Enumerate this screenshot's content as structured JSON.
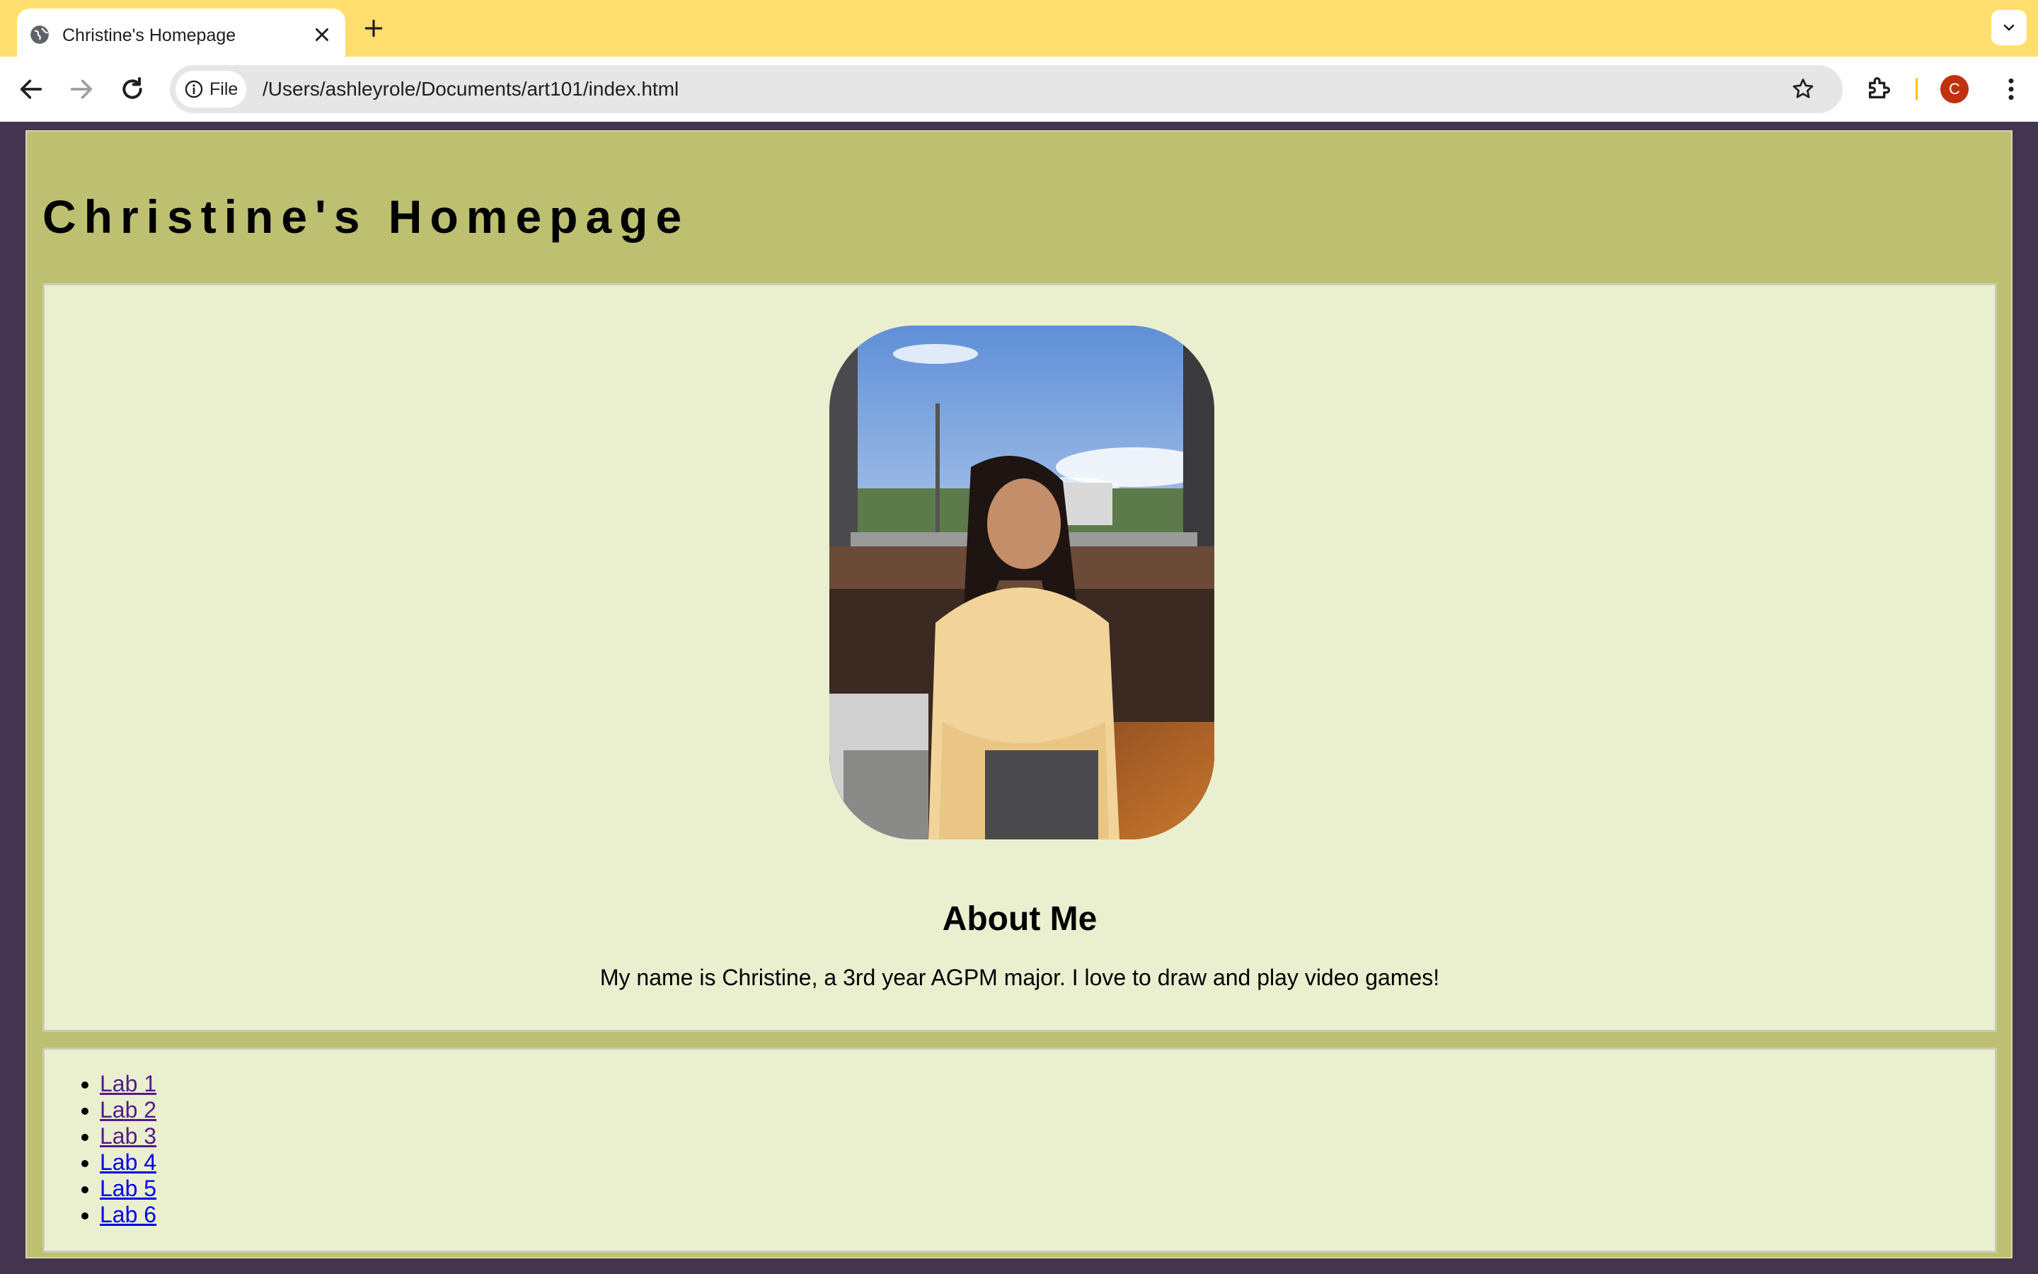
{
  "browser": {
    "tab": {
      "title": "Christine's Homepage"
    },
    "address_bar": {
      "chip_label": "File",
      "url": "/Users/ashleyrole/Documents/art101/index.html"
    },
    "profile_initial": "C",
    "colors": {
      "tabstrip": "#ffde6e",
      "avatar": "#c0310e"
    }
  },
  "page": {
    "title": "Christine's Homepage",
    "about": {
      "heading": "About Me",
      "text": "My name is Christine, a 3rd year AGPM major. I love to draw and play video games!"
    },
    "labs": [
      {
        "label": "Lab 1",
        "visited": true
      },
      {
        "label": "Lab 2",
        "visited": true
      },
      {
        "label": "Lab 3",
        "visited": true
      },
      {
        "label": "Lab 4",
        "visited": false
      },
      {
        "label": "Lab 5",
        "visited": false
      },
      {
        "label": "Lab 6",
        "visited": false
      }
    ],
    "colors": {
      "background": "#45344f",
      "frame": "#bcc070",
      "card": "#eaefd0",
      "link_visited": "#551a8b",
      "link_unvisited": "#0000ee"
    }
  }
}
